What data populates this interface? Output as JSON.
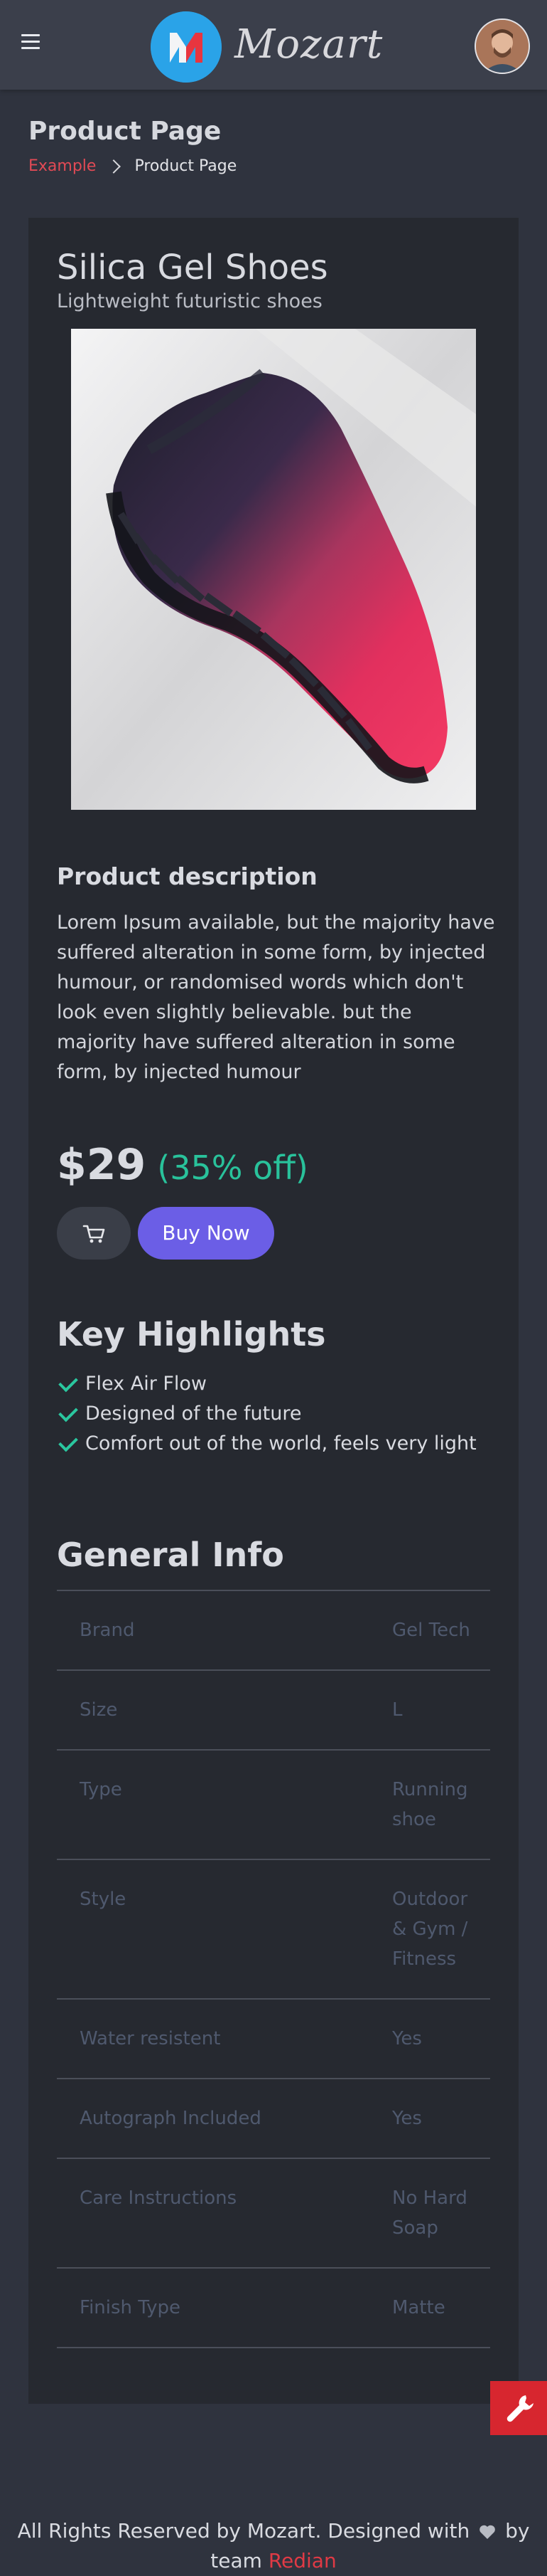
{
  "app": {
    "brand_name": "Mozart",
    "logo_letter": "M"
  },
  "header": {
    "page_title": "Product Page",
    "breadcrumb": [
      {
        "label": "Example"
      },
      {
        "label": "Product Page"
      }
    ]
  },
  "product": {
    "title": "Silica Gel Shoes",
    "subtitle": "Lightweight futuristic shoes",
    "description_heading": "Product description",
    "description": "Lorem Ipsum available, but the majority have suffered alteration in some form, by injected humour, or randomised words which don't look even slightly believable. but the majority have suffered alteration in some form, by injected humour",
    "price": "$29",
    "discount": "(35% off)",
    "buy_label": "Buy Now",
    "highlights_heading": "Key Highlights",
    "highlights": [
      "Flex Air Flow",
      "Designed of the future",
      "Comfort out of the world, feels very light"
    ]
  },
  "general_info": {
    "heading": "General Info",
    "rows": [
      {
        "key": "Brand",
        "value": "Gel Tech"
      },
      {
        "key": "Size",
        "value": "L"
      },
      {
        "key": "Type",
        "value": "Running shoe"
      },
      {
        "key": "Style",
        "value": "Outdoor & Gym / Fitness"
      },
      {
        "key": "Water resistent",
        "value": "Yes"
      },
      {
        "key": "Autograph Included",
        "value": "Yes"
      },
      {
        "key": "Care Instructions",
        "value": "No Hard Soap"
      },
      {
        "key": "Finish Type",
        "value": "Matte"
      }
    ]
  },
  "footer": {
    "text_before": "All Rights Reserved by Mozart. Designed with",
    "text_after": "by team",
    "team_name": "Redian"
  },
  "colors": {
    "accent_purple": "#6b5ee6",
    "discount_green": "#29c29b",
    "link_red": "#e24a55",
    "fab_red": "#d7262f"
  },
  "icons": {
    "menu": "hamburger-icon",
    "cart": "cart-icon",
    "check": "check-icon",
    "heart": "heart-icon",
    "wrench": "wrench-icon"
  }
}
